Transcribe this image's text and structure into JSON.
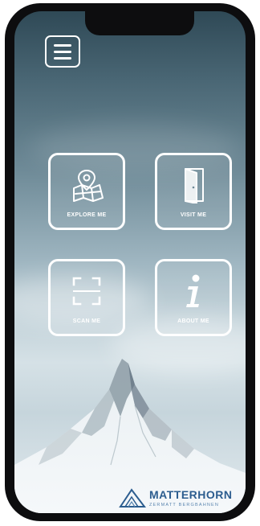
{
  "menu": {
    "icon": "hamburger-menu-icon"
  },
  "tiles": [
    {
      "label": "EXPLORE ME",
      "icon": "map-pin-icon"
    },
    {
      "label": "VISIT ME",
      "icon": "door-icon"
    },
    {
      "label": "SCAN ME",
      "icon": "scan-frame-icon"
    },
    {
      "label": "ABOUT ME",
      "icon": "info-icon"
    }
  ],
  "brand": {
    "name": "MATTERHORN",
    "subtitle": "ZERMATT BERGBAHNEN",
    "logo_icon": "mountain-logo-icon"
  },
  "colors": {
    "tile_border": "#ffffff",
    "brand_blue": "#2c5d8f",
    "phone_frame": "#0d0d0f"
  }
}
